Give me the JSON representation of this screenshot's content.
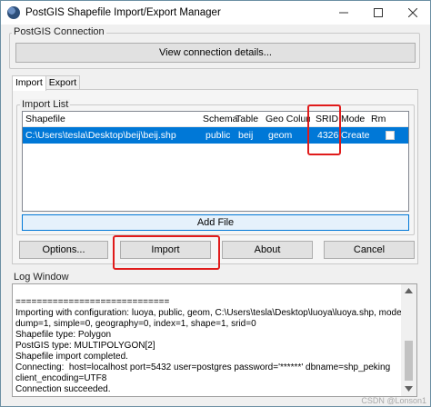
{
  "window": {
    "title": "PostGIS Shapefile Import/Export Manager",
    "controls": {
      "minimize": "—",
      "maximize": "☐",
      "close": "✕"
    }
  },
  "connection": {
    "group_title": "PostGIS Connection",
    "view_button": "View connection details..."
  },
  "tabs": [
    {
      "label": "Import",
      "active": true
    },
    {
      "label": "Export",
      "active": false
    }
  ],
  "import_list": {
    "group_title": "Import List",
    "columns": [
      "Shapefile",
      "Schema",
      "Table",
      "Geo Column",
      "SRID",
      "Mode",
      "Rm"
    ],
    "rows": [
      {
        "shapefile": "C:\\Users\\tesla\\Desktop\\beij\\beij.shp",
        "schema": "public",
        "table": "beij",
        "geo_column": "geom",
        "srid": "4326",
        "mode": "Create",
        "rm": false,
        "selected": true
      }
    ],
    "add_file_button": "Add File"
  },
  "actions": {
    "options": "Options...",
    "import": "Import",
    "about": "About",
    "cancel": "Cancel"
  },
  "log": {
    "group_title": "Log Window",
    "lines": [
      "",
      "=============================",
      "Importing with configuration: luoya, public, geom, C:\\Users\\tesla\\Desktop\\luoya\\luoya.shp, mode=c,",
      "dump=1, simple=0, geography=0, index=1, shape=1, srid=0",
      "Shapefile type: Polygon",
      "PostGIS type: MULTIPOLYGON[2]",
      "Shapefile import completed.",
      "Connecting:  host=localhost port=5432 user=postgres password='******' dbname=shp_peking",
      "client_encoding=UTF8",
      "Connection succeeded."
    ]
  },
  "watermark": "CSDN @Lonson1",
  "colors": {
    "selection": "#0078d7",
    "highlight_box": "#e01b1b",
    "focus_border": "#0078d7"
  },
  "icons": {
    "app": "postgis-elephant-icon",
    "checkbox": "checkbox-icon",
    "scroll_up": "scroll-up-arrow-icon",
    "scroll_down": "scroll-down-arrow-icon"
  }
}
